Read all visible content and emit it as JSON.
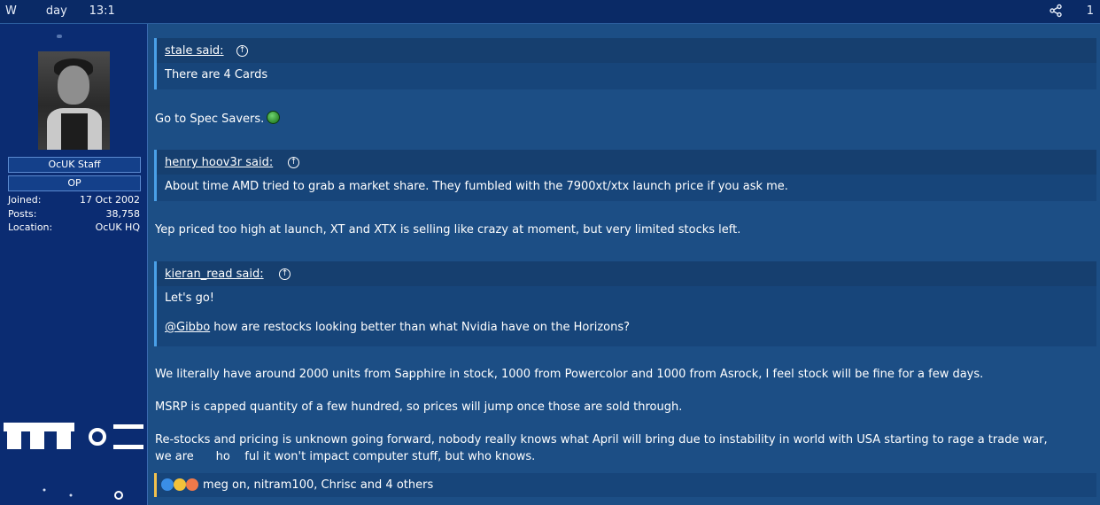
{
  "topbar": {
    "left_text": "W        day      13:1",
    "share_icon": "share-icon",
    "count": "1"
  },
  "sidebar": {
    "role": "OcUK Staff",
    "op_badge": "OP",
    "stats": [
      {
        "key": "Joined:",
        "value": "17 Oct 2002"
      },
      {
        "key": "Posts:",
        "value": "38,758"
      },
      {
        "key": "Location:",
        "value": "OcUK HQ"
      }
    ]
  },
  "quotes": [
    {
      "author": "stale said:",
      "lines": [
        "There are 4 Cards"
      ]
    },
    {
      "author": "henry hoov3r said:",
      "lines": [
        "About time AMD tried to grab a market share. They fumbled with the 7900xt/xtx launch price if you ask me."
      ]
    },
    {
      "author": "kieran_read said:",
      "lines": [
        "Let's go!",
        "how are restocks looking better than what Nvidia have on the Horizons?"
      ],
      "mention": "@Gibbo"
    }
  ],
  "paragraphs": {
    "p1": "Go to Spec Savers.",
    "p2": "Yep priced too high at launch, XT and XTX is selling like crazy at moment, but very limited stocks left.",
    "p3": "We literally have around 2000 units from Sapphire in stock, 1000 from Powercolor and 1000 from Asrock, I feel stock will be fine for a few days.",
    "p4": "MSRP is capped quantity of a few hundred, so prices will jump once those are sold through.",
    "p5_line1": "Re-stocks and pricing is unknown going forward, nobody really knows what April will bring due to instability in world with USA starting to rage a trade war,",
    "p5_line2": "we are      ho    ful it won't impact computer stuff, but who knows."
  },
  "reactions": {
    "text": "meg    on, nitram100, Chrisc and 4 others",
    "icons": [
      "like-icon",
      "laugh-icon",
      "love-icon"
    ]
  }
}
